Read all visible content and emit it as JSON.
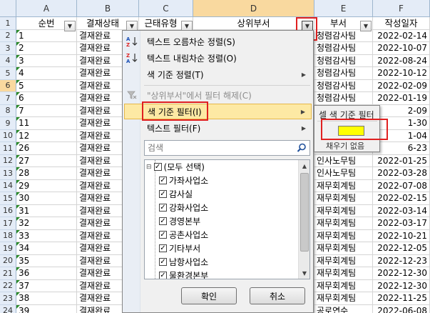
{
  "columns": [
    {
      "letter": "A",
      "header": "순번"
    },
    {
      "letter": "B",
      "header": "결재상태"
    },
    {
      "letter": "C",
      "header": "근태유형"
    },
    {
      "letter": "D",
      "header": "상위부서"
    },
    {
      "letter": "E",
      "header": "부서"
    },
    {
      "letter": "F",
      "header": "작성일자"
    }
  ],
  "row_numbers": [
    "1",
    "2",
    "3",
    "4",
    "5",
    "6",
    "7",
    "8",
    "9",
    "10",
    "11",
    "12",
    "13",
    "14",
    "15",
    "16",
    "17",
    "18",
    "19",
    "20",
    "21",
    "22",
    "23",
    "24"
  ],
  "rows": [
    {
      "a": "1",
      "b": "결재완료",
      "e": "청렴감사팀",
      "f": "2022-02-14"
    },
    {
      "a": "2",
      "b": "결재완료",
      "e": "청렴감사팀",
      "f": "2022-10-07"
    },
    {
      "a": "3",
      "b": "결재완료",
      "e": "청렴감사팀",
      "f": "2022-08-24"
    },
    {
      "a": "4",
      "b": "결재완료",
      "e": "청렴감사팀",
      "f": "2022-10-12"
    },
    {
      "a": "5",
      "b": "결재완료",
      "e": "청렴감사팀",
      "f": "2022-02-09"
    },
    {
      "a": "6",
      "b": "결재완료",
      "e": "청렴감사팀",
      "f": "2022-01-19"
    },
    {
      "a": "7",
      "b": "결재완료",
      "e": "",
      "f": "2-09"
    },
    {
      "a": "11",
      "b": "결재완료",
      "e": "",
      "f": "1-30"
    },
    {
      "a": "12",
      "b": "결재완료",
      "e": "",
      "f": "1-04"
    },
    {
      "a": "26",
      "b": "결재완료",
      "e": "",
      "f": "6-23"
    },
    {
      "a": "27",
      "b": "결재완료",
      "e": "인사노무팀",
      "f": "2022-01-25"
    },
    {
      "a": "28",
      "b": "결재완료",
      "e": "인사노무팀",
      "f": "2022-03-28"
    },
    {
      "a": "29",
      "b": "결재완료",
      "e": "재무회계팀",
      "f": "2022-07-08"
    },
    {
      "a": "30",
      "b": "결재완료",
      "e": "재무회계팀",
      "f": "2022-02-15"
    },
    {
      "a": "31",
      "b": "결재완료",
      "e": "재무회계팀",
      "f": "2022-03-14"
    },
    {
      "a": "32",
      "b": "결재완료",
      "e": "재무회계팀",
      "f": "2022-03-17"
    },
    {
      "a": "33",
      "b": "결재완료",
      "e": "재무회계팀",
      "f": "2022-10-21"
    },
    {
      "a": "34",
      "b": "결재완료",
      "e": "재무회계팀",
      "f": "2022-12-05"
    },
    {
      "a": "35",
      "b": "결재완료",
      "e": "재무회계팀",
      "f": "2022-12-23"
    },
    {
      "a": "36",
      "b": "결재완료",
      "e": "재무회계팀",
      "f": "2022-12-30"
    },
    {
      "a": "37",
      "b": "결재완료",
      "e": "재무회계팀",
      "f": "2022-12-30"
    },
    {
      "a": "38",
      "b": "결재완료",
      "e": "재무회계팀",
      "f": "2022-11-25"
    },
    {
      "a": "39",
      "b": "결재완료",
      "e": "공로연수",
      "f": "2022-06-08"
    }
  ],
  "menu": {
    "sort_asc": "텍스트 오름차순 정렬(S)",
    "sort_desc": "텍스트 내림차순 정렬(O)",
    "sort_color": "색 기준 정렬(T)",
    "clear_filter": "\"상위부서\"에서 필터 해제(C)",
    "color_filter": "색 기준 필터(I)",
    "text_filter": "텍스트 필터(F)",
    "search_placeholder": "검색",
    "list": [
      "(모두 선택)",
      "가좌사업소",
      "감사실",
      "강화사업소",
      "경영본부",
      "공촌사업소",
      "기타부서",
      "남항사업소",
      "물환경본부"
    ],
    "ok": "확인",
    "cancel": "취소"
  },
  "submenu": {
    "title": "셀 색 기준 필터",
    "no_fill": "채우기 없음",
    "swatch_color": "#ffff00"
  },
  "icons": {
    "sort_asc": "sort-ascending-icon",
    "sort_desc": "sort-descending-icon",
    "clear_filter": "clear-filter-icon",
    "search": "search-icon"
  }
}
